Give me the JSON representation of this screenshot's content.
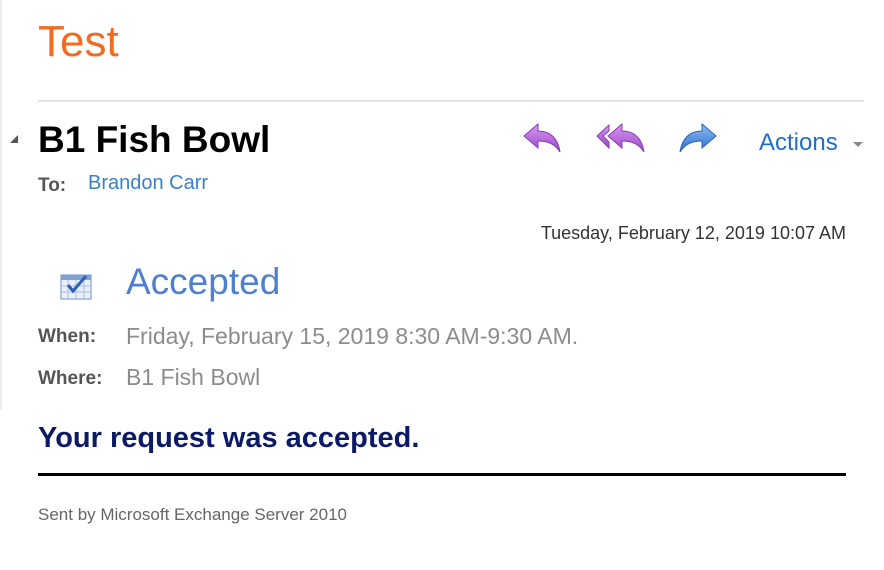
{
  "folder": {
    "title": "Test"
  },
  "message_header": {
    "subject": "B1 Fish Bowl",
    "to_label": "To:",
    "to_value": "Brandon Carr",
    "timestamp": "Tuesday, February 12, 2019 10:07 AM",
    "toolbar": {
      "reply_icon": "reply-icon",
      "reply_all_icon": "reply-all-icon",
      "forward_icon": "forward-icon",
      "actions_label": "Actions"
    }
  },
  "meeting": {
    "status_icon": "calendar-accepted-icon",
    "status": "Accepted",
    "when_label": "When:",
    "when_value": "Friday, February 15, 2019 8:30 AM-9:30 AM.",
    "where_label": "Where:",
    "where_value": "B1 Fish Bowl"
  },
  "body": {
    "message": "Your request was accepted.",
    "footer": "Sent by Microsoft Exchange Server 2010"
  },
  "colors": {
    "folder_title": "#f26b21",
    "link": "#3a7fc8",
    "actions": "#1e6fc7",
    "status": "#4f7fd0",
    "message": "#0b1a66",
    "reply_icon": "#b05fd6",
    "forward_icon": "#3f7fd6"
  }
}
